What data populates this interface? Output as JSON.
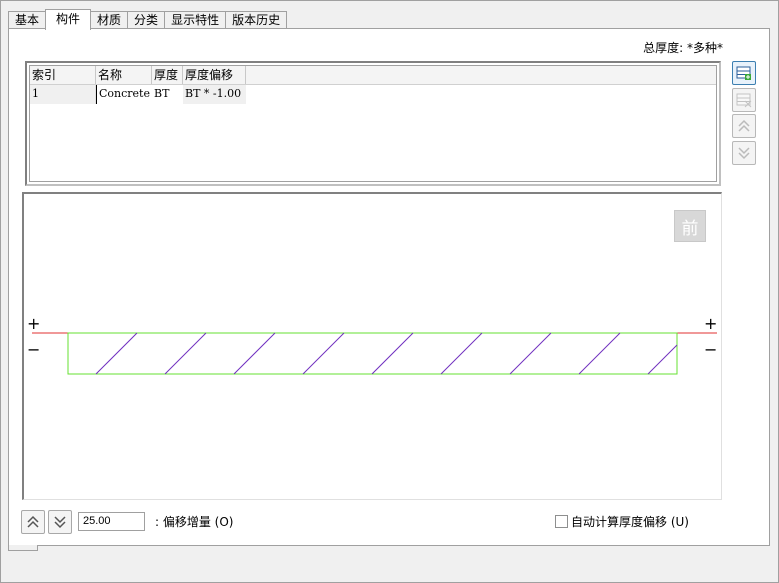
{
  "tabs": [
    "基本",
    "构件",
    "材质",
    "分类",
    "显示特性",
    "版本历史"
  ],
  "active_tab": "构件",
  "total_thickness": "总厚度: *多种*",
  "table": {
    "headers": [
      "索引",
      "名称",
      "厚度",
      "厚度偏移"
    ],
    "rows": [
      [
        "1",
        "Concrete",
        "BT",
        "BT * -1.00"
      ]
    ]
  },
  "side_buttons": [
    {
      "name": "insert-row",
      "enabled": true
    },
    {
      "name": "delete-row",
      "enabled": false
    },
    {
      "name": "move-up",
      "enabled": false
    },
    {
      "name": "move-down",
      "enabled": false
    }
  ],
  "preview": {
    "front_button": "前",
    "plus": "+",
    "minus": "−"
  },
  "offset": {
    "value": "25.00",
    "label": ": 偏移增量 (O)"
  },
  "auto_offset": {
    "label": "自动计算厚度偏移 (U)",
    "checked": false
  },
  "colors": {
    "reference_line": "#e03030",
    "layer_outline": "#66e030",
    "hatch": "#7030c0"
  }
}
